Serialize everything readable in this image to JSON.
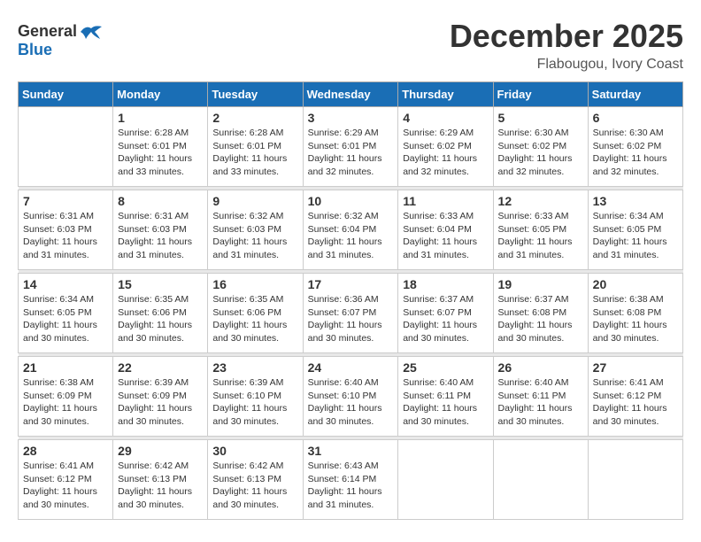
{
  "logo": {
    "general": "General",
    "blue": "Blue"
  },
  "title": "December 2025",
  "location": "Flabougou, Ivory Coast",
  "days_of_week": [
    "Sunday",
    "Monday",
    "Tuesday",
    "Wednesday",
    "Thursday",
    "Friday",
    "Saturday"
  ],
  "weeks": [
    [
      {
        "day": "",
        "sunrise": "",
        "sunset": "",
        "daylight": ""
      },
      {
        "day": "1",
        "sunrise": "Sunrise: 6:28 AM",
        "sunset": "Sunset: 6:01 PM",
        "daylight": "Daylight: 11 hours and 33 minutes."
      },
      {
        "day": "2",
        "sunrise": "Sunrise: 6:28 AM",
        "sunset": "Sunset: 6:01 PM",
        "daylight": "Daylight: 11 hours and 33 minutes."
      },
      {
        "day": "3",
        "sunrise": "Sunrise: 6:29 AM",
        "sunset": "Sunset: 6:01 PM",
        "daylight": "Daylight: 11 hours and 32 minutes."
      },
      {
        "day": "4",
        "sunrise": "Sunrise: 6:29 AM",
        "sunset": "Sunset: 6:02 PM",
        "daylight": "Daylight: 11 hours and 32 minutes."
      },
      {
        "day": "5",
        "sunrise": "Sunrise: 6:30 AM",
        "sunset": "Sunset: 6:02 PM",
        "daylight": "Daylight: 11 hours and 32 minutes."
      },
      {
        "day": "6",
        "sunrise": "Sunrise: 6:30 AM",
        "sunset": "Sunset: 6:02 PM",
        "daylight": "Daylight: 11 hours and 32 minutes."
      }
    ],
    [
      {
        "day": "7",
        "sunrise": "Sunrise: 6:31 AM",
        "sunset": "Sunset: 6:03 PM",
        "daylight": "Daylight: 11 hours and 31 minutes."
      },
      {
        "day": "8",
        "sunrise": "Sunrise: 6:31 AM",
        "sunset": "Sunset: 6:03 PM",
        "daylight": "Daylight: 11 hours and 31 minutes."
      },
      {
        "day": "9",
        "sunrise": "Sunrise: 6:32 AM",
        "sunset": "Sunset: 6:03 PM",
        "daylight": "Daylight: 11 hours and 31 minutes."
      },
      {
        "day": "10",
        "sunrise": "Sunrise: 6:32 AM",
        "sunset": "Sunset: 6:04 PM",
        "daylight": "Daylight: 11 hours and 31 minutes."
      },
      {
        "day": "11",
        "sunrise": "Sunrise: 6:33 AM",
        "sunset": "Sunset: 6:04 PM",
        "daylight": "Daylight: 11 hours and 31 minutes."
      },
      {
        "day": "12",
        "sunrise": "Sunrise: 6:33 AM",
        "sunset": "Sunset: 6:05 PM",
        "daylight": "Daylight: 11 hours and 31 minutes."
      },
      {
        "day": "13",
        "sunrise": "Sunrise: 6:34 AM",
        "sunset": "Sunset: 6:05 PM",
        "daylight": "Daylight: 11 hours and 31 minutes."
      }
    ],
    [
      {
        "day": "14",
        "sunrise": "Sunrise: 6:34 AM",
        "sunset": "Sunset: 6:05 PM",
        "daylight": "Daylight: 11 hours and 30 minutes."
      },
      {
        "day": "15",
        "sunrise": "Sunrise: 6:35 AM",
        "sunset": "Sunset: 6:06 PM",
        "daylight": "Daylight: 11 hours and 30 minutes."
      },
      {
        "day": "16",
        "sunrise": "Sunrise: 6:35 AM",
        "sunset": "Sunset: 6:06 PM",
        "daylight": "Daylight: 11 hours and 30 minutes."
      },
      {
        "day": "17",
        "sunrise": "Sunrise: 6:36 AM",
        "sunset": "Sunset: 6:07 PM",
        "daylight": "Daylight: 11 hours and 30 minutes."
      },
      {
        "day": "18",
        "sunrise": "Sunrise: 6:37 AM",
        "sunset": "Sunset: 6:07 PM",
        "daylight": "Daylight: 11 hours and 30 minutes."
      },
      {
        "day": "19",
        "sunrise": "Sunrise: 6:37 AM",
        "sunset": "Sunset: 6:08 PM",
        "daylight": "Daylight: 11 hours and 30 minutes."
      },
      {
        "day": "20",
        "sunrise": "Sunrise: 6:38 AM",
        "sunset": "Sunset: 6:08 PM",
        "daylight": "Daylight: 11 hours and 30 minutes."
      }
    ],
    [
      {
        "day": "21",
        "sunrise": "Sunrise: 6:38 AM",
        "sunset": "Sunset: 6:09 PM",
        "daylight": "Daylight: 11 hours and 30 minutes."
      },
      {
        "day": "22",
        "sunrise": "Sunrise: 6:39 AM",
        "sunset": "Sunset: 6:09 PM",
        "daylight": "Daylight: 11 hours and 30 minutes."
      },
      {
        "day": "23",
        "sunrise": "Sunrise: 6:39 AM",
        "sunset": "Sunset: 6:10 PM",
        "daylight": "Daylight: 11 hours and 30 minutes."
      },
      {
        "day": "24",
        "sunrise": "Sunrise: 6:40 AM",
        "sunset": "Sunset: 6:10 PM",
        "daylight": "Daylight: 11 hours and 30 minutes."
      },
      {
        "day": "25",
        "sunrise": "Sunrise: 6:40 AM",
        "sunset": "Sunset: 6:11 PM",
        "daylight": "Daylight: 11 hours and 30 minutes."
      },
      {
        "day": "26",
        "sunrise": "Sunrise: 6:40 AM",
        "sunset": "Sunset: 6:11 PM",
        "daylight": "Daylight: 11 hours and 30 minutes."
      },
      {
        "day": "27",
        "sunrise": "Sunrise: 6:41 AM",
        "sunset": "Sunset: 6:12 PM",
        "daylight": "Daylight: 11 hours and 30 minutes."
      }
    ],
    [
      {
        "day": "28",
        "sunrise": "Sunrise: 6:41 AM",
        "sunset": "Sunset: 6:12 PM",
        "daylight": "Daylight: 11 hours and 30 minutes."
      },
      {
        "day": "29",
        "sunrise": "Sunrise: 6:42 AM",
        "sunset": "Sunset: 6:13 PM",
        "daylight": "Daylight: 11 hours and 30 minutes."
      },
      {
        "day": "30",
        "sunrise": "Sunrise: 6:42 AM",
        "sunset": "Sunset: 6:13 PM",
        "daylight": "Daylight: 11 hours and 30 minutes."
      },
      {
        "day": "31",
        "sunrise": "Sunrise: 6:43 AM",
        "sunset": "Sunset: 6:14 PM",
        "daylight": "Daylight: 11 hours and 31 minutes."
      },
      {
        "day": "",
        "sunrise": "",
        "sunset": "",
        "daylight": ""
      },
      {
        "day": "",
        "sunrise": "",
        "sunset": "",
        "daylight": ""
      },
      {
        "day": "",
        "sunrise": "",
        "sunset": "",
        "daylight": ""
      }
    ]
  ]
}
